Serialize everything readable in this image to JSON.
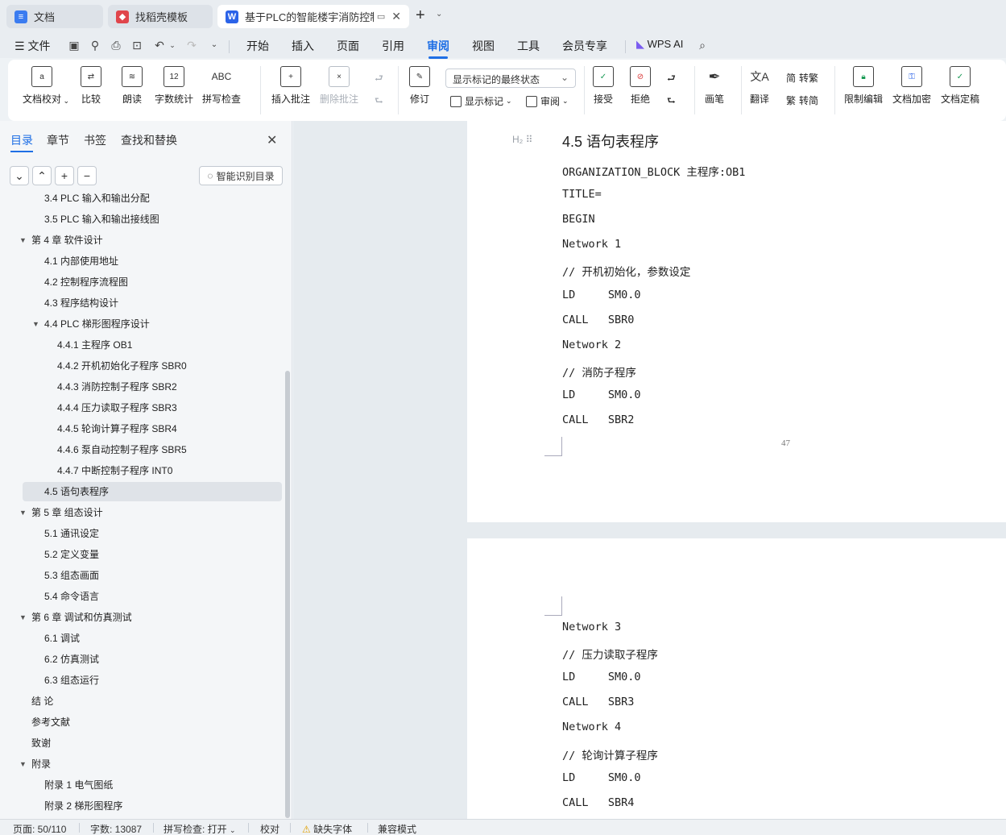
{
  "tabs": [
    {
      "label": "文档",
      "icon": "docs-icon",
      "color": "#3b7cf0"
    },
    {
      "label": "找稻壳模板",
      "icon": "daoke-icon",
      "color": "#e0454b"
    },
    {
      "label": "基于PLC的智能楼宇消防控制系",
      "icon": "word-icon",
      "color": "#2b63e8"
    }
  ],
  "menu": {
    "file": "文件",
    "items": [
      "开始",
      "插入",
      "页面",
      "引用",
      "审阅",
      "视图",
      "工具",
      "会员专享"
    ],
    "active": "审阅",
    "wps_ai": "WPS AI"
  },
  "ribbon": {
    "doc_check": "文档校对",
    "compare": "比较",
    "read_aloud": "朗读",
    "word_count": "字数统计",
    "spell_check": "拼写检查",
    "insert_comment": "插入批注",
    "delete_comment": "删除批注",
    "track_changes": "修订",
    "markup_select": "显示标记的最终状态",
    "show_markup": "显示标记",
    "review": "审阅",
    "accept": "接受",
    "reject": "拒绝",
    "pen": "画笔",
    "translate": "翻译",
    "to_traditional": "转繁",
    "to_simplified": "转简",
    "restrict_edit": "限制编辑",
    "encrypt": "文档加密",
    "finalize": "文档定稿",
    "icon_text_wordcount": "12",
    "icon_text_spell": "ABC"
  },
  "sidepane": {
    "tabs": [
      "目录",
      "章节",
      "书签",
      "查找和替换"
    ],
    "smart_btn": "智能识别目录",
    "toc": [
      {
        "text": "3.4   PLC 输入和输出分配",
        "level": 2
      },
      {
        "text": "3.5   PLC 输入和输出接线图",
        "level": 2
      },
      {
        "text": "第 4 章   软件设计",
        "level": 1,
        "expanded": true
      },
      {
        "text": "4.1   内部使用地址",
        "level": 2
      },
      {
        "text": "4.2   控制程序流程图",
        "level": 2
      },
      {
        "text": "4.3   程序结构设计",
        "level": 2
      },
      {
        "text": "4.4   PLC 梯形图程序设计",
        "level": 2,
        "expanded": true
      },
      {
        "text": "4.4.1  主程序 OB1",
        "level": 3
      },
      {
        "text": "4.4.2  开机初始化子程序 SBR0",
        "level": 3
      },
      {
        "text": "4.4.3 消防控制子程序 SBR2",
        "level": 3
      },
      {
        "text": "4.4.4  压力读取子程序 SBR3",
        "level": 3
      },
      {
        "text": "4.4.5  轮询计算子程序 SBR4",
        "level": 3
      },
      {
        "text": "4.4.6    泵自动控制子程序 SBR5",
        "level": 3
      },
      {
        "text": "4.4.7    中断控制子程序 INT0",
        "level": 3
      },
      {
        "text": "4.5   语句表程序",
        "level": 2,
        "selected": true
      },
      {
        "text": "第 5 章  组态设计",
        "level": 1,
        "expanded": true
      },
      {
        "text": "5.1   通讯设定",
        "level": 2
      },
      {
        "text": "5.2   定义变量",
        "level": 2
      },
      {
        "text": "5.3   组态画面",
        "level": 2
      },
      {
        "text": "5.4   命令语言",
        "level": 2
      },
      {
        "text": "第 6 章   调试和仿真测试",
        "level": 1,
        "expanded": true
      },
      {
        "text": "6.1   调试",
        "level": 2
      },
      {
        "text": "6.2   仿真测试",
        "level": 2
      },
      {
        "text": "6.3   组态运行",
        "level": 2
      },
      {
        "text": "结   论",
        "level": 1
      },
      {
        "text": "参考文献",
        "level": 1
      },
      {
        "text": "致谢",
        "level": 1
      },
      {
        "text": "附录",
        "level": 1,
        "expanded": true
      },
      {
        "text": "附录 1    电气图纸",
        "level": 2
      },
      {
        "text": "附录 2    梯形图程序",
        "level": 2
      }
    ]
  },
  "document": {
    "heading_mark": "H₂",
    "heading": "4.5   语句表程序",
    "page1_lines": [
      "ORGANIZATION_BLOCK 主程序:OB1",
      "TITLE=",
      "BEGIN",
      "Network 1",
      "// 开机初始化，参数设定",
      "LD     SM0.0",
      "CALL   SBR0",
      "Network 2",
      "// 消防子程序",
      "LD     SM0.0",
      "CALL   SBR2"
    ],
    "page_number": "47",
    "page2_lines": [
      "Network 3",
      "// 压力读取子程序",
      "LD     SM0.0",
      "CALL   SBR3",
      "Network 4",
      "// 轮询计算子程序",
      "LD     SM0.0",
      "CALL   SBR4"
    ]
  },
  "status": {
    "page": "页面: 50/110",
    "words": "字数: 13087",
    "spell": "拼写检查: 打开",
    "proof": "校对",
    "missing_font": "缺失字体",
    "compat": "兼容模式"
  }
}
